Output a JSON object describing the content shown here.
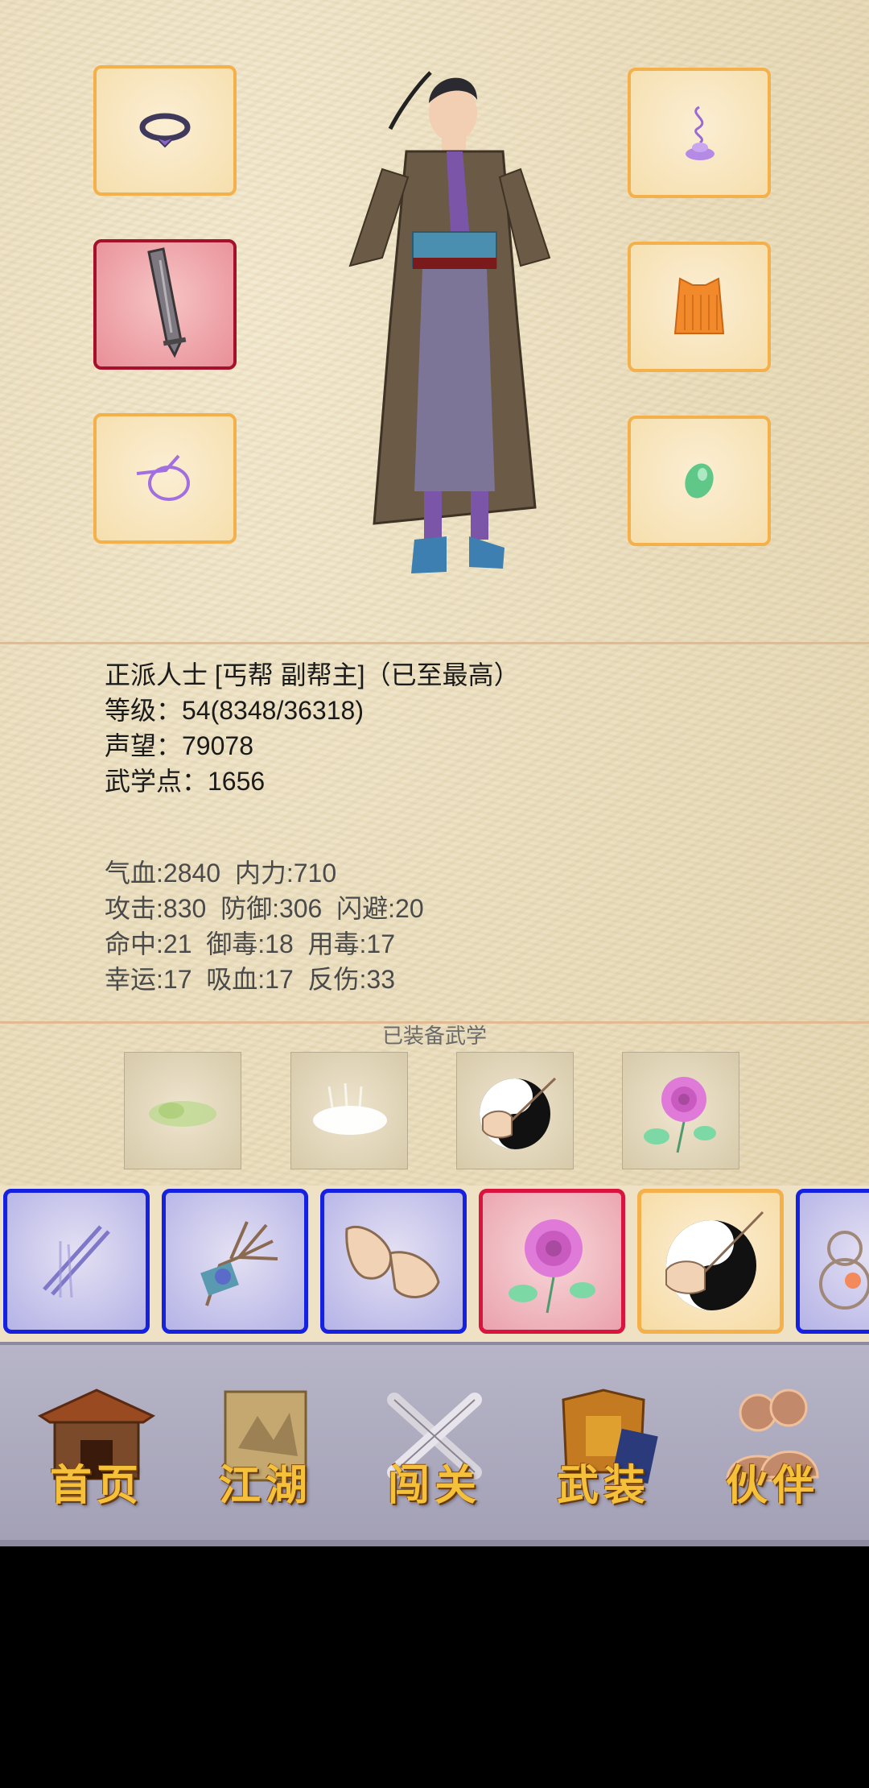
{
  "profile": {
    "title_line": "正派人士 [丐帮 副帮主]（已至最高）",
    "level_line": "等级：54(8348/36318)",
    "fame_line": "声望：79078",
    "martial_points_line": "武学点：1656"
  },
  "stats": {
    "row1": "气血:2840  内力:710",
    "row2": "攻击:830  防御:306  闪避:20",
    "row3": "命中:21  御毒:18  用毒:17",
    "row4": "幸运:17  吸血:17  反伤:33"
  },
  "equipped_skills_label": "已装备武学",
  "equipment_slots": {
    "left": [
      "ring-icon",
      "sword-icon",
      "pendant-icon"
    ],
    "right": [
      "incense-icon",
      "armor-icon",
      "jade-icon"
    ]
  },
  "skill_cards": [
    {
      "icon": "chopsticks-icon",
      "frame": "blue"
    },
    {
      "icon": "claw-hand-icon",
      "frame": "blue"
    },
    {
      "icon": "fist-icon",
      "frame": "blue"
    },
    {
      "icon": "rose-icon",
      "frame": "red"
    },
    {
      "icon": "taiji-fist-icon",
      "frame": "gold"
    },
    {
      "icon": "gourd-icon",
      "frame": "blue"
    }
  ],
  "nav": {
    "home": "首页",
    "jianghu": "江湖",
    "challenge": "闯关",
    "equipment": "武装",
    "partners": "伙伴"
  },
  "colors": {
    "slot_border": "#f4b04a",
    "selected_red": "#a5102a",
    "card_blue": "#1520e0",
    "card_red": "#d8143f",
    "nav_label": "#f5c13b"
  }
}
